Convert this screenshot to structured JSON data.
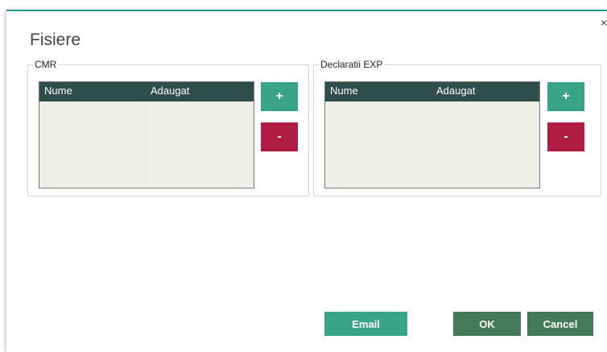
{
  "dialog": {
    "title": "Fisiere",
    "close_label": "×"
  },
  "colors": {
    "accent": "#3aa586",
    "danger": "#b01d44",
    "header": "#2e4d4b",
    "primary": "#44795a"
  },
  "groups": [
    {
      "legend": "CMR",
      "columns": [
        "Nume",
        "Adaugat"
      ],
      "add_label": "+",
      "remove_label": "-"
    },
    {
      "legend": "Declaratii EXP",
      "columns": [
        "Nume",
        "Adaugat"
      ],
      "add_label": "+",
      "remove_label": "-"
    }
  ],
  "footer": {
    "email_label": "Email",
    "ok_label": "OK",
    "cancel_label": "Cancel"
  }
}
